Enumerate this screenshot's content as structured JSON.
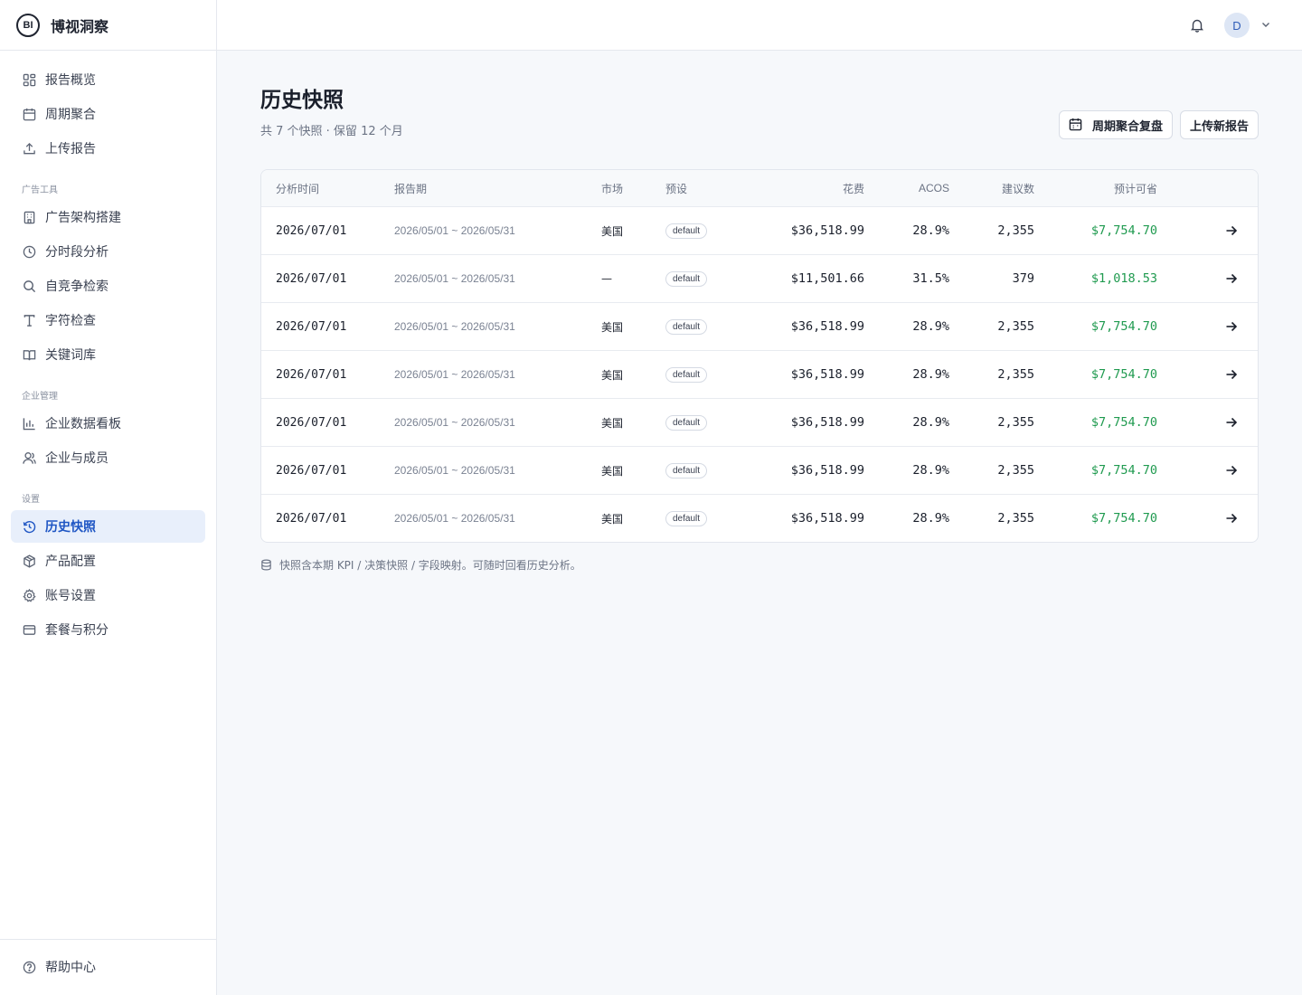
{
  "brand": {
    "logo_text": "BI",
    "name": "博视洞察"
  },
  "sidebar": {
    "main_items": [
      {
        "label": "报告概览",
        "icon": "dashboard-grid-icon"
      },
      {
        "label": "周期聚合",
        "icon": "calendar-icon"
      },
      {
        "label": "上传报告",
        "icon": "upload-icon"
      }
    ],
    "sections": [
      {
        "title": "广告工具",
        "items": [
          {
            "label": "广告架构搭建",
            "icon": "building-icon"
          },
          {
            "label": "分时段分析",
            "icon": "clock-icon"
          },
          {
            "label": "自竞争检索",
            "icon": "search-icon"
          },
          {
            "label": "字符检查",
            "icon": "text-icon"
          },
          {
            "label": "关键词库",
            "icon": "book-icon"
          }
        ]
      },
      {
        "title": "企业管理",
        "items": [
          {
            "label": "企业数据看板",
            "icon": "bar-chart-icon"
          },
          {
            "label": "企业与成员",
            "icon": "user-icon"
          }
        ]
      },
      {
        "title": "设置",
        "items": [
          {
            "label": "历史快照",
            "icon": "history-icon",
            "active": true
          },
          {
            "label": "产品配置",
            "icon": "box-icon"
          },
          {
            "label": "账号设置",
            "icon": "gear-icon"
          },
          {
            "label": "套餐与积分",
            "icon": "credit-card-icon"
          }
        ]
      }
    ],
    "footer": {
      "label": "帮助中心",
      "icon": "help-circle-icon"
    }
  },
  "topbar": {
    "avatar_letter": "D",
    "bell_icon": "bell-icon",
    "caret_icon": "chevron-down-icon"
  },
  "page": {
    "title": "历史快照",
    "subtitle": "共 7 个快照 · 保留 12 个月",
    "actions": [
      {
        "label": "周期聚合复盘",
        "icon": "calendar-icon"
      },
      {
        "label": "上传新报告"
      }
    ]
  },
  "table": {
    "columns": [
      "分析时间",
      "报告期",
      "市场",
      "预设",
      "花费",
      "ACOS",
      "建议数",
      "预计可省"
    ],
    "rows": [
      {
        "time": "2026/07/01",
        "period": "2026/05/01 ~ 2026/05/31",
        "market": "美国",
        "preset": "default",
        "spend": "$36,518.99",
        "acos": "28.9%",
        "suggestions": "2,355",
        "savings": "$7,754.70"
      },
      {
        "time": "2026/07/01",
        "period": "2026/05/01 ~ 2026/05/31",
        "market": "—",
        "preset": "default",
        "spend": "$11,501.66",
        "acos": "31.5%",
        "suggestions": "379",
        "savings": "$1,018.53"
      },
      {
        "time": "2026/07/01",
        "period": "2026/05/01 ~ 2026/05/31",
        "market": "美国",
        "preset": "default",
        "spend": "$36,518.99",
        "acos": "28.9%",
        "suggestions": "2,355",
        "savings": "$7,754.70"
      },
      {
        "time": "2026/07/01",
        "period": "2026/05/01 ~ 2026/05/31",
        "market": "美国",
        "preset": "default",
        "spend": "$36,518.99",
        "acos": "28.9%",
        "suggestions": "2,355",
        "savings": "$7,754.70"
      },
      {
        "time": "2026/07/01",
        "period": "2026/05/01 ~ 2026/05/31",
        "market": "美国",
        "preset": "default",
        "spend": "$36,518.99",
        "acos": "28.9%",
        "suggestions": "2,355",
        "savings": "$7,754.70"
      },
      {
        "time": "2026/07/01",
        "period": "2026/05/01 ~ 2026/05/31",
        "market": "美国",
        "preset": "default",
        "spend": "$36,518.99",
        "acos": "28.9%",
        "suggestions": "2,355",
        "savings": "$7,754.70"
      },
      {
        "time": "2026/07/01",
        "period": "2026/05/01 ~ 2026/05/31",
        "market": "美国",
        "preset": "default",
        "spend": "$36,518.99",
        "acos": "28.9%",
        "suggestions": "2,355",
        "savings": "$7,754.70"
      }
    ]
  },
  "note": {
    "text": "快照含本期 KPI / 决策快照 / 字段映射。可随时回看历史分析。",
    "icon": "database-icon"
  },
  "colors": {
    "accent": "#1f56c4",
    "active_bg": "#e8effb",
    "savings_green": "#1f9a4f"
  }
}
